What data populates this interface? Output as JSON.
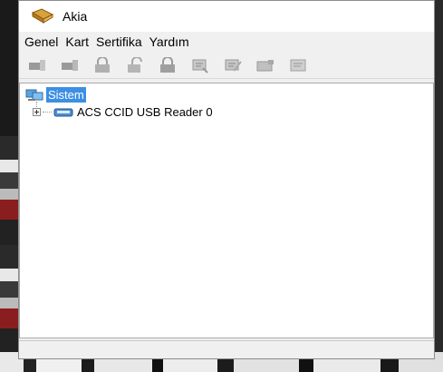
{
  "window": {
    "title": "Akia",
    "app_icon": "tag-icon"
  },
  "menubar": {
    "items": [
      {
        "label": "Genel"
      },
      {
        "label": "Kart"
      },
      {
        "label": "Sertifika"
      },
      {
        "label": "Yardım"
      }
    ]
  },
  "toolbar": {
    "buttons": [
      {
        "icon": "card-reader-icon"
      },
      {
        "icon": "card-reader-eject-icon"
      },
      {
        "icon": "lock-icon"
      },
      {
        "icon": "unlock-icon"
      },
      {
        "icon": "lock-closed-icon"
      },
      {
        "icon": "certificate-import-icon"
      },
      {
        "icon": "certificate-edit-icon"
      },
      {
        "icon": "card-icon"
      },
      {
        "icon": "certificate-view-icon"
      }
    ]
  },
  "tree": {
    "root": {
      "label": "Sistem",
      "icon": "computer-icon",
      "selected": true
    },
    "children": [
      {
        "label": "ACS CCID USB Reader 0",
        "icon": "reader-device-icon",
        "expanded": false
      }
    ]
  },
  "colors": {
    "selection": "#3c8fe3",
    "window_bg": "#f0f0f0"
  }
}
